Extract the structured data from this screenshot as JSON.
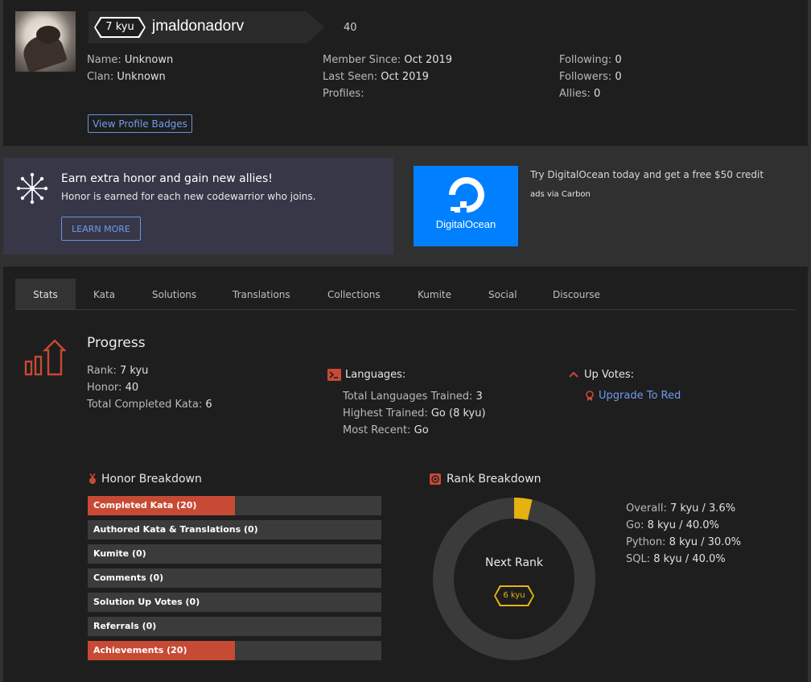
{
  "profile": {
    "rank_badge": "7 kyu",
    "username": "jmaldonadorv",
    "honor": "40",
    "name_key": "Name:",
    "name_val": "Unknown",
    "clan_key": "Clan:",
    "clan_val": "Unknown",
    "member_since_key": "Member Since:",
    "member_since_val": "Oct 2019",
    "last_seen_key": "Last Seen:",
    "last_seen_val": "Oct 2019",
    "profiles_key": "Profiles:",
    "following_key": "Following:",
    "following_val": "0",
    "followers_key": "Followers:",
    "followers_val": "0",
    "allies_key": "Allies:",
    "allies_val": "0",
    "badges_button": "View Profile Badges"
  },
  "promo": {
    "title": "Earn extra honor and gain new allies!",
    "subtitle": "Honor is earned for each new codewarrior who joins.",
    "button": "LEARN MORE"
  },
  "ad": {
    "logo_text": "DigitalOcean",
    "text": "Try DigitalOcean today and get a free $50 credit",
    "via": "ads via Carbon"
  },
  "tabs": [
    {
      "label": "Stats",
      "active": true
    },
    {
      "label": "Kata"
    },
    {
      "label": "Solutions"
    },
    {
      "label": "Translations"
    },
    {
      "label": "Collections"
    },
    {
      "label": "Kumite"
    },
    {
      "label": "Social"
    },
    {
      "label": "Discourse"
    }
  ],
  "progress": {
    "title": "Progress",
    "rank_key": "Rank:",
    "rank_val": "7 kyu",
    "honor_key": "Honor:",
    "honor_val": "40",
    "completed_key": "Total Completed Kata:",
    "completed_val": "6"
  },
  "languages": {
    "title": "Languages:",
    "trained_key": "Total Languages Trained:",
    "trained_val": "3",
    "highest_key": "Highest Trained:",
    "highest_val": "Go (8 kyu)",
    "recent_key": "Most Recent:",
    "recent_val": "Go"
  },
  "upvotes": {
    "title": "Up Votes:",
    "link": "Upgrade To Red"
  },
  "honor_breakdown": {
    "title": "Honor Breakdown",
    "items": [
      {
        "label": "Completed Kata (20)",
        "fraction": 0.5
      },
      {
        "label": "Authored Kata & Translations (0)",
        "fraction": 0
      },
      {
        "label": "Kumite (0)",
        "fraction": 0
      },
      {
        "label": "Comments (0)",
        "fraction": 0
      },
      {
        "label": "Solution Up Votes (0)",
        "fraction": 0
      },
      {
        "label": "Referrals (0)",
        "fraction": 0
      },
      {
        "label": "Achievements (20)",
        "fraction": 0.5
      }
    ]
  },
  "rank_breakdown": {
    "title": "Rank Breakdown",
    "progress_fraction": 0.036,
    "next_rank_label": "Next Rank",
    "next_rank": "6 kyu",
    "overall_key": "Overall:",
    "overall_val": "7 kyu / 3.6%",
    "go_key": "Go:",
    "go_val": "8 kyu / 40.0%",
    "python_key": "Python:",
    "python_val": "8 kyu / 30.0%",
    "sql_key": "SQL:",
    "sql_val": "8 kyu / 40.0%"
  },
  "colors": {
    "accent_red": "#c74a34",
    "link_blue": "#6f9cf0",
    "rank_yellow": "#e6b211",
    "do_blue": "#0080ff"
  }
}
